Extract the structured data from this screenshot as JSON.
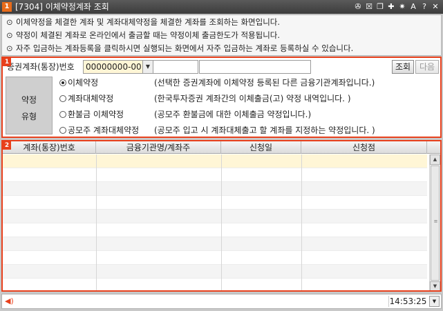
{
  "window": {
    "number": "1",
    "title": "[7304] 이체약정계좌 조회",
    "controls": [
      "pin-icon",
      "window-icon",
      "restore-icon",
      "pushpin-icon",
      "settings-icon",
      "font-size-icon",
      "help-icon",
      "close-icon"
    ]
  },
  "info": {
    "bullet": "⊙",
    "lines": [
      "이체약정을 체결한 계좌 및 계좌대체약정을 체결한 계좌를 조회하는 화면입니다.",
      "약정이 체결된 계좌로 온라인에서 출금할 때는 약정이체 출금한도가 적용됩니다.",
      "자주 입금하는 계좌등록을 클릭하시면 실행되는 화면에서 자주 입금하는 계좌로 등록하실 수 있습니다."
    ]
  },
  "section1": {
    "badge": "1",
    "account_label": "증권계좌(통장)번호",
    "account_value": "00000000-00",
    "query_button": "조회",
    "next_button": "다음",
    "agreement_title_1": "약정",
    "agreement_title_2": "유형",
    "options": [
      {
        "label": "이체약정",
        "desc": "(선택한 증권계좌에 이체약정 등록된 다른 금융기관계좌입니다.)",
        "selected": true
      },
      {
        "label": "계좌대체약정",
        "desc": "(한국투자증권 계좌간의 이체출금(고) 약정 내역입니다. )",
        "selected": false
      },
      {
        "label": "환불금 이체약정",
        "desc": "(공모주 환불금에 대한 이체출금 약정입니다.)",
        "selected": false
      },
      {
        "label": "공모주 계좌대체약정",
        "desc": "(공모주 입고 시 계좌대체출고 할 계좌를 지정하는 약정입니다. )",
        "selected": false
      }
    ]
  },
  "section2": {
    "badge": "2",
    "columns": [
      "계좌(통장)번호",
      "금융기관명/계좌주",
      "신청일",
      "신청점"
    ],
    "rows": []
  },
  "status": {
    "time": "14:53:25"
  },
  "colors": {
    "accent": "#e8401c",
    "selected_row": "#fff6d6",
    "title_bar": "#3c3c3c"
  }
}
